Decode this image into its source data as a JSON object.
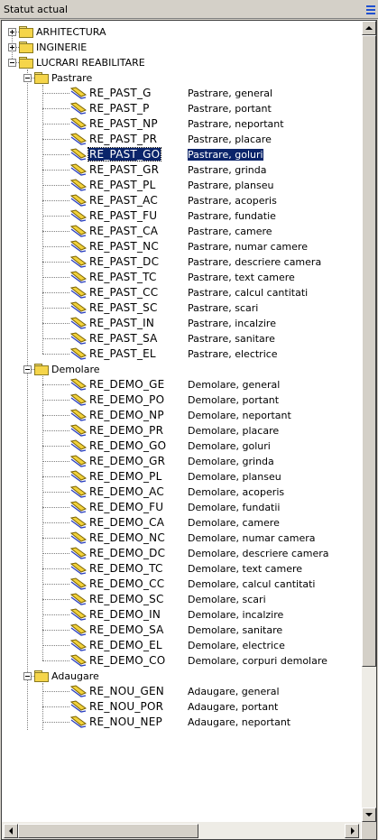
{
  "header": {
    "title": "Statut actual"
  },
  "colors": {
    "selection": "#0a246a",
    "folder": "#f5d54a",
    "layer_icon": "#f2d23c"
  },
  "tree": [
    {
      "type": "folder",
      "level": 0,
      "label": "ARHITECTURA",
      "state": "collapsed"
    },
    {
      "type": "folder",
      "level": 0,
      "label": "INGINERIE",
      "state": "collapsed"
    },
    {
      "type": "folder",
      "level": 0,
      "label": "LUCRARI REABILITARE",
      "state": "expanded"
    },
    {
      "type": "folder",
      "level": 1,
      "label": "Pastrare",
      "state": "expanded"
    },
    {
      "type": "layer",
      "code": "RE_PAST_G",
      "desc": "Pastrare, general"
    },
    {
      "type": "layer",
      "code": "RE_PAST_P",
      "desc": "Pastrare, portant"
    },
    {
      "type": "layer",
      "code": "RE_PAST_NP",
      "desc": "Pastrare, neportant"
    },
    {
      "type": "layer",
      "code": "RE_PAST_PR",
      "desc": "Pastrare, placare"
    },
    {
      "type": "layer",
      "code": "RE_PAST_GO",
      "desc": "Pastrare, goluri",
      "selected": true
    },
    {
      "type": "layer",
      "code": "RE_PAST_GR",
      "desc": "Pastrare, grinda"
    },
    {
      "type": "layer",
      "code": "RE_PAST_PL",
      "desc": "Pastrare, planseu"
    },
    {
      "type": "layer",
      "code": "RE_PAST_AC",
      "desc": "Pastrare, acoperis"
    },
    {
      "type": "layer",
      "code": "RE_PAST_FU",
      "desc": "Pastrare, fundatie"
    },
    {
      "type": "layer",
      "code": "RE_PAST_CA",
      "desc": "Pastrare, camere"
    },
    {
      "type": "layer",
      "code": "RE_PAST_NC",
      "desc": "Pastrare, numar camere"
    },
    {
      "type": "layer",
      "code": "RE_PAST_DC",
      "desc": "Pastrare, descriere camera"
    },
    {
      "type": "layer",
      "code": "RE_PAST_TC",
      "desc": "Pastrare, text camere"
    },
    {
      "type": "layer",
      "code": "RE_PAST_CC",
      "desc": "Pastrare, calcul cantitati"
    },
    {
      "type": "layer",
      "code": "RE_PAST_SC",
      "desc": "Pastrare, scari"
    },
    {
      "type": "layer",
      "code": "RE_PAST_IN",
      "desc": "Pastrare, incalzire"
    },
    {
      "type": "layer",
      "code": "RE_PAST_SA",
      "desc": "Pastrare, sanitare"
    },
    {
      "type": "layer",
      "code": "RE_PAST_EL",
      "desc": "Pastrare, electrice"
    },
    {
      "type": "folder",
      "level": 1,
      "label": "Demolare",
      "state": "expanded"
    },
    {
      "type": "layer",
      "code": "RE_DEMO_GE",
      "desc": "Demolare, general"
    },
    {
      "type": "layer",
      "code": "RE_DEMO_PO",
      "desc": "Demolare, portant"
    },
    {
      "type": "layer",
      "code": "RE_DEMO_NP",
      "desc": "Demolare, neportant"
    },
    {
      "type": "layer",
      "code": "RE_DEMO_PR",
      "desc": "Demolare, placare"
    },
    {
      "type": "layer",
      "code": "RE_DEMO_GO",
      "desc": "Demolare, goluri"
    },
    {
      "type": "layer",
      "code": "RE_DEMO_GR",
      "desc": "Demolare, grinda"
    },
    {
      "type": "layer",
      "code": "RE_DEMO_PL",
      "desc": "Demolare, planseu"
    },
    {
      "type": "layer",
      "code": "RE_DEMO_AC",
      "desc": "Demolare, acoperis"
    },
    {
      "type": "layer",
      "code": "RE_DEMO_FU",
      "desc": "Demolare, fundatii"
    },
    {
      "type": "layer",
      "code": "RE_DEMO_CA",
      "desc": "Demolare, camere"
    },
    {
      "type": "layer",
      "code": "RE_DEMO_NC",
      "desc": "Demolare, numar camera"
    },
    {
      "type": "layer",
      "code": "RE_DEMO_DC",
      "desc": "Demolare, descriere camera"
    },
    {
      "type": "layer",
      "code": "RE_DEMO_TC",
      "desc": "Demolare, text camere"
    },
    {
      "type": "layer",
      "code": "RE_DEMO_CC",
      "desc": "Demolare, calcul cantitati"
    },
    {
      "type": "layer",
      "code": "RE_DEMO_SC",
      "desc": "Demolare, scari"
    },
    {
      "type": "layer",
      "code": "RE_DEMO_IN",
      "desc": "Demolare, incalzire"
    },
    {
      "type": "layer",
      "code": "RE_DEMO_SA",
      "desc": "Demolare, sanitare"
    },
    {
      "type": "layer",
      "code": "RE_DEMO_EL",
      "desc": "Demolare, electrice"
    },
    {
      "type": "layer",
      "code": "RE_DEMO_CO",
      "desc": "Demolare, corpuri demolare"
    },
    {
      "type": "folder",
      "level": 1,
      "label": "Adaugare",
      "state": "expanded"
    },
    {
      "type": "layer",
      "code": "RE_NOU_GEN",
      "desc": "Adaugare, general"
    },
    {
      "type": "layer",
      "code": "RE_NOU_POR",
      "desc": "Adaugare, portant"
    },
    {
      "type": "layer",
      "code": "RE_NOU_NEP",
      "desc": "Adaugare, neportant"
    }
  ]
}
